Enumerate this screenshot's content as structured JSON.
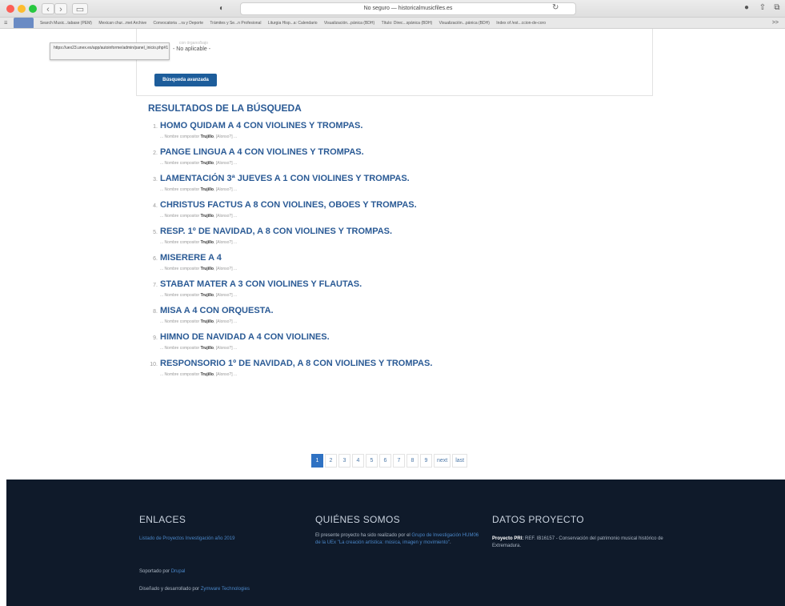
{
  "browser": {
    "url_text": "No seguro — historicalmusicfiles.es",
    "bookmarks": [
      "Search Music...tabase (PEM)",
      "Mexican chur...met Archive",
      "Convocatoria ...ra y Deporte",
      "Trámites y Se...n Profesional",
      "Liturgia Hisp...a: Calendario",
      "Visualización...pánica (BDH)",
      "Título: Direc...spánica (BDH)",
      "Visualización...pánica (BDH)",
      "Index of /est...ccion-de-coro"
    ],
    "bookmark_more": ">>"
  },
  "tooltip": {
    "text": "https://uex23.unex.es/app/autoinforme/admin/panel_inicio.php#1"
  },
  "search": {
    "faded_option": "con órgano/bajo",
    "option_label": "- No aplicable -",
    "advanced_button": "Búsqueda avanzada"
  },
  "results": {
    "heading": "RESULTADOS DE LA BÚSQUEDA",
    "meta_prefix": "... Nombre compositor",
    "meta_suffix": "[Alonso?] ...",
    "items": [
      {
        "num": "1.",
        "title": "HOMO QUIDAM A 4 CON VIOLINES Y TROMPAS.",
        "composer": "Trujillo"
      },
      {
        "num": "2.",
        "title": "PANGE LINGUA A 4 CON VIOLINES Y TROMPAS.",
        "composer": "Trujillo"
      },
      {
        "num": "3.",
        "title": "LAMENTACIÓN 3ª JUEVES A 1 CON VIOLINES Y TROMPAS.",
        "composer": "Trujillo"
      },
      {
        "num": "4.",
        "title": "CHRISTUS FACTUS A 8 CON VIOLINES, OBOES Y TROMPAS.",
        "composer": "Trujillo"
      },
      {
        "num": "5.",
        "title": "RESP. 1º DE NAVIDAD, A 8 CON VIOLINES Y TROMPAS.",
        "composer": "Trujillo"
      },
      {
        "num": "6.",
        "title": "MISERERE A 4",
        "composer": "Trujillo"
      },
      {
        "num": "7.",
        "title": "STABAT MATER A 3 CON VIOLINES Y FLAUTAS.",
        "composer": "Trujillo"
      },
      {
        "num": "8.",
        "title": "MISA A 4 CON ORQUESTA.",
        "composer": "Trujillo"
      },
      {
        "num": "9.",
        "title": "HIMNO DE NAVIDAD A 4 CON VIOLINES.",
        "composer": "Trujillo"
      },
      {
        "num": "10.",
        "title": "RESPONSORIO 1º DE NAVIDAD, A 8 CON VIOLINES Y TROMPAS.",
        "composer": "Trujillo"
      }
    ]
  },
  "pager": {
    "pages": [
      "1",
      "2",
      "3",
      "4",
      "5",
      "6",
      "7",
      "8",
      "9"
    ],
    "current": "1",
    "next": "next",
    "last": "last"
  },
  "footer": {
    "links_heading": "ENLACES",
    "links_item": "Listado de Proyectos Investigación año 2019",
    "powered_prefix": "Soportado por",
    "powered_link": "Drupal",
    "designed_prefix": "Diseñado y desarrollado por",
    "designed_link": "Zymware Technologies",
    "about_heading": "QUIÉNES SOMOS",
    "about_prefix": "El presente proyecto ha sido realizado por el",
    "about_link": "Grupo de Investigación HUM06 de la UEx \"La creación artística: música, imagen y movimiento\"",
    "about_suffix": ".",
    "project_heading": "DATOS PROYECTO",
    "project_label": "Proyecto PRI:",
    "project_text": "REF. IB16157 - Conservación del patrimonio musical histórico de Extremadura."
  },
  "colors": {
    "accent": "#2a5a95",
    "button": "#1d5d9b",
    "pager_active": "#2f72c3",
    "footer_bg": "#0f1a2a"
  }
}
